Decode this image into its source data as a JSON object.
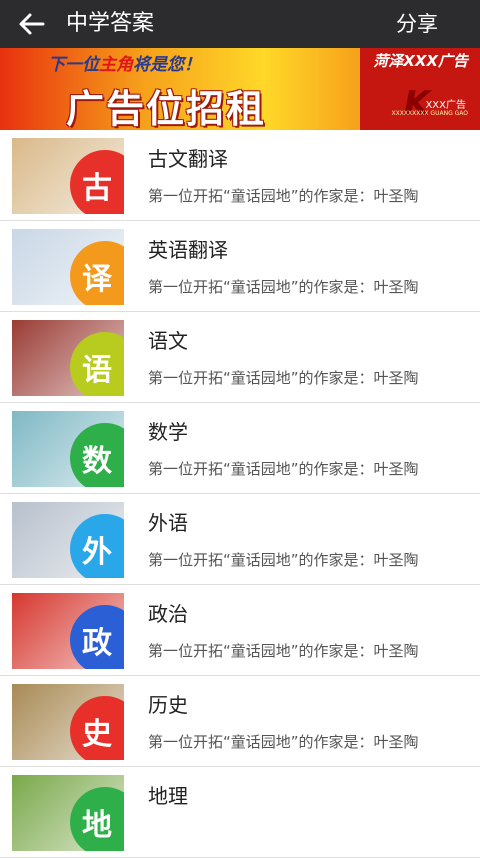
{
  "header": {
    "title": "中学答案",
    "share_label": "分享"
  },
  "banner": {
    "top_prefix": "下一位",
    "top_highlight": "主角",
    "top_suffix": "将是您！",
    "main": "广告位招租",
    "city_text": "菏泽XXX广告",
    "logo_letter": "K",
    "logo_text": "XXX广告",
    "logo_sub": "XXXXXXXXX GUANG GAO"
  },
  "items": [
    {
      "title": "古文翻译",
      "desc": "第一位开拓“童话园地”的作家是：叶圣陶",
      "glyph": "古",
      "color": "#e8302a",
      "bg": "#d9b98a",
      "icon": "ancient-text-thumbnail"
    },
    {
      "title": "英语翻译",
      "desc": "第一位开拓“童话园地”的作家是：叶圣陶",
      "glyph": "译",
      "color": "#f39a1c",
      "bg": "#c9d7e6",
      "icon": "english-translation-thumbnail"
    },
    {
      "title": "语文",
      "desc": "第一位开拓“童话园地”的作家是：叶圣陶",
      "glyph": "语",
      "color": "#b7cc1f",
      "bg": "#9a3b34",
      "icon": "chinese-books-thumbnail"
    },
    {
      "title": "数学",
      "desc": "第一位开拓“童话园地”的作家是：叶圣陶",
      "glyph": "数",
      "color": "#2faf4a",
      "bg": "#7fb9c5",
      "icon": "math-pencils-thumbnail"
    },
    {
      "title": "外语",
      "desc": "第一位开拓“童话园地”的作家是：叶圣陶",
      "glyph": "外",
      "color": "#2aa7e8",
      "bg": "#b7c0cc",
      "icon": "students-thumbnail"
    },
    {
      "title": "政治",
      "desc": "第一位开拓“童话园地”的作家是：叶圣陶",
      "glyph": "政",
      "color": "#2b5fd6",
      "bg": "#d6372f",
      "icon": "politics-thumbnail"
    },
    {
      "title": "历史",
      "desc": "第一位开拓“童话园地”的作家是：叶圣陶",
      "glyph": "史",
      "color": "#e8302a",
      "bg": "#a88a55",
      "icon": "terracotta-thumbnail"
    },
    {
      "title": "地理",
      "desc": "",
      "glyph": "地",
      "color": "#2faf4a",
      "bg": "#7aa84a",
      "icon": "geography-thumbnail"
    }
  ]
}
